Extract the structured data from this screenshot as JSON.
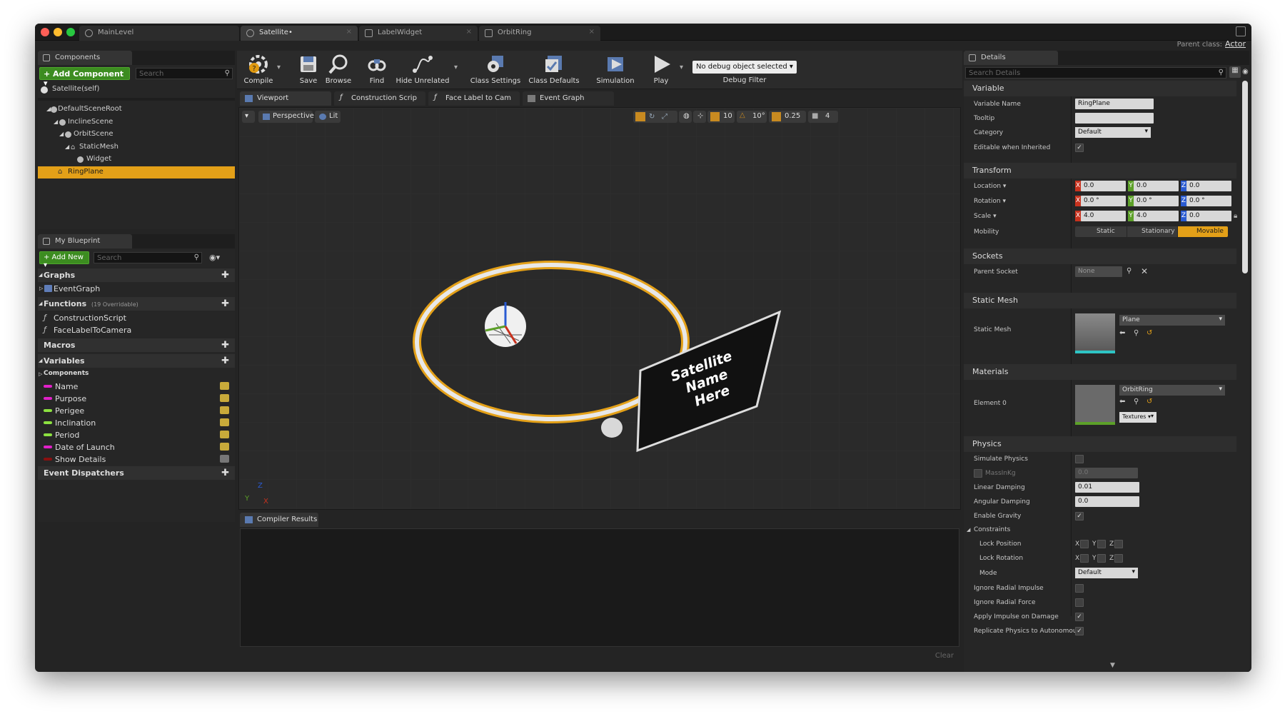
{
  "tabs": [
    {
      "label": "MainLevel"
    },
    {
      "label": "Satellite•"
    },
    {
      "label": "LabelWidget"
    },
    {
      "label": "OrbitRing"
    }
  ],
  "parent_class": {
    "label": "Parent class:",
    "value": "Actor"
  },
  "components": {
    "tab": "Components",
    "add_button": "+ Add Component ▾",
    "search_placeholder": "Search",
    "self_item": "Satellite(self)",
    "tree": [
      {
        "label": "DefaultSceneRoot",
        "indent": 1
      },
      {
        "label": "InclineScene",
        "indent": 2
      },
      {
        "label": "OrbitScene",
        "indent": 3
      },
      {
        "label": "StaticMesh",
        "indent": 4
      },
      {
        "label": "Widget",
        "indent": 5
      },
      {
        "label": "RingPlane",
        "indent": 2,
        "selected": true
      }
    ]
  },
  "my_blueprint": {
    "tab": "My Blueprint",
    "add_button": "+ Add New ▾",
    "search_placeholder": "Search",
    "graphs_label": "Graphs",
    "event_graph": "EventGraph",
    "functions_label": "Functions",
    "functions_count": "(19 Overridable)",
    "functions": [
      "ConstructionScript",
      "FaceLabelToCamera"
    ],
    "macros_label": "Macros",
    "variables_label": "Variables",
    "components_label": "Components",
    "variables": [
      {
        "name": "Name",
        "color": "#e020c8"
      },
      {
        "name": "Purpose",
        "color": "#e020c8"
      },
      {
        "name": "Perigee",
        "color": "#8ce040"
      },
      {
        "name": "Inclination",
        "color": "#8ce040"
      },
      {
        "name": "Period",
        "color": "#8ce040"
      },
      {
        "name": "Date of Launch",
        "color": "#e020c8"
      },
      {
        "name": "Show Details",
        "color": "#8a1010"
      }
    ],
    "dispatchers_label": "Event Dispatchers"
  },
  "toolbar": {
    "compile": "Compile",
    "save": "Save",
    "browse": "Browse",
    "find": "Find",
    "hide_unrelated": "Hide Unrelated",
    "class_settings": "Class Settings",
    "class_defaults": "Class Defaults",
    "simulation": "Simulation",
    "play": "Play",
    "debug_select": "No debug object selected ▾",
    "debug_filter": "Debug Filter"
  },
  "center_tabs": [
    {
      "label": "Viewport"
    },
    {
      "label": "Construction Scrip"
    },
    {
      "label": "Face Label to Cam"
    },
    {
      "label": "Event Graph"
    }
  ],
  "viewport": {
    "perspective": "Perspective",
    "lit": "Lit",
    "grid_snap": "10",
    "rot_snap": "10°",
    "scale_snap": "0.25",
    "camera_speed": "4",
    "label_text_1": "Satellite",
    "label_text_2": "Name",
    "label_text_3": "Here",
    "axis_x": "X",
    "axis_y": "Y",
    "axis_z": "Z"
  },
  "compiler": {
    "tab": "Compiler Results",
    "clear": "Clear"
  },
  "details": {
    "tab": "Details",
    "search_placeholder": "Search Details",
    "variable": {
      "section": "Variable",
      "name_label": "Variable Name",
      "name_value": "RingPlane",
      "tooltip_label": "Tooltip",
      "category_label": "Category",
      "category_value": "Default",
      "editable_label": "Editable when Inherited"
    },
    "transform": {
      "section": "Transform",
      "location_label": "Location ▾",
      "location": [
        "0.0",
        "0.0",
        "0.0"
      ],
      "rotation_label": "Rotation ▾",
      "rotation": [
        "0.0 °",
        "0.0 °",
        "0.0 °"
      ],
      "scale_label": "Scale ▾",
      "scale": [
        "4.0",
        "4.0",
        "0.0"
      ],
      "mobility_label": "Mobility",
      "mobility": [
        "Static",
        "Stationary",
        "Movable"
      ]
    },
    "sockets": {
      "section": "Sockets",
      "parent_label": "Parent Socket",
      "parent_value": "None"
    },
    "static_mesh": {
      "section": "Static Mesh",
      "label": "Static Mesh",
      "value": "Plane"
    },
    "materials": {
      "section": "Materials",
      "label": "Element 0",
      "value": "OrbitRing",
      "textures": "Textures ▾"
    },
    "physics": {
      "section": "Physics",
      "simulate": "Simulate Physics",
      "mass": "MassInKg",
      "mass_value": "0.0",
      "linear": "Linear Damping",
      "linear_value": "0.01",
      "angular": "Angular Damping",
      "angular_value": "0.0",
      "gravity": "Enable Gravity",
      "constraints": "Constraints",
      "lock_pos": "Lock Position",
      "lock_rot": "Lock Rotation",
      "mode": "Mode",
      "mode_value": "Default",
      "radial_impulse": "Ignore Radial Impulse",
      "radial_force": "Ignore Radial Force",
      "apply_impulse": "Apply Impulse on Damage",
      "replicate": "Replicate Physics to Autonomou"
    }
  }
}
